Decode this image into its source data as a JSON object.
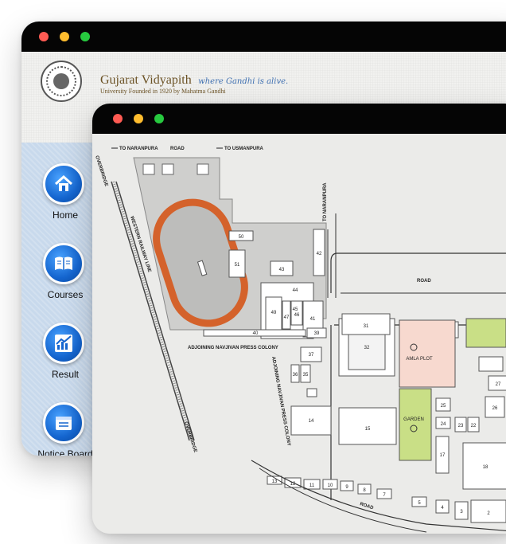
{
  "back_window": {
    "brand": {
      "name": "Gujarat Vidyapith",
      "tagline": "where Gandhi is alive.",
      "subtitle": "University Founded in 1920 by Mahatma Gandhi"
    },
    "nav": [
      {
        "label": "Home",
        "icon": "home-icon"
      },
      {
        "label": "Courses",
        "icon": "book-icon"
      },
      {
        "label": "Result",
        "icon": "chart-icon"
      },
      {
        "label": "Notice Board",
        "icon": "notice-icon"
      }
    ]
  },
  "map": {
    "labels": {
      "to_naranpura_top": "TO NARANPURA",
      "road_top": "ROAD",
      "to_usmanpura": "TO USMANPURA",
      "to_naranpura_side": "TO NARANPURA",
      "road_mid": "ROAD",
      "road_bottom": "ROAD",
      "adjoining_left": "ADJOINING NAVJIVAN PRESS COLONY",
      "adjoining_vertical": "ADJOINING NAVJIVAN PRESS COLONY",
      "rail_main": "WESTERN RAILWAY LINE",
      "rail_left": "OVERBRIDGE",
      "rail_bottom": "OVERBRIDGE",
      "amla_plot": "AMLA PLOT",
      "garden": "GARDEN"
    },
    "buildings": [
      "50",
      "51",
      "43",
      "44",
      "42",
      "49",
      "47",
      "46",
      "41",
      "45",
      "40",
      "39",
      "37",
      "36",
      "35",
      "38",
      "32",
      "31",
      "30",
      "29",
      "14",
      "15",
      "13",
      "12",
      "11",
      "10",
      "9",
      "8",
      "7",
      "6",
      "5",
      "4",
      "3",
      "2",
      "25",
      "24",
      "23",
      "22",
      "17",
      "18",
      "26",
      "27",
      "16"
    ]
  },
  "colors": {
    "titlebar": "#050505",
    "close": "#ff5b53",
    "minimize": "#ffbd2e",
    "maximize": "#27c93f",
    "nav_icon": "#1566d0",
    "track": "#d4622b",
    "amla_plot": "#f7d9cf",
    "garden": "#c9df86"
  }
}
